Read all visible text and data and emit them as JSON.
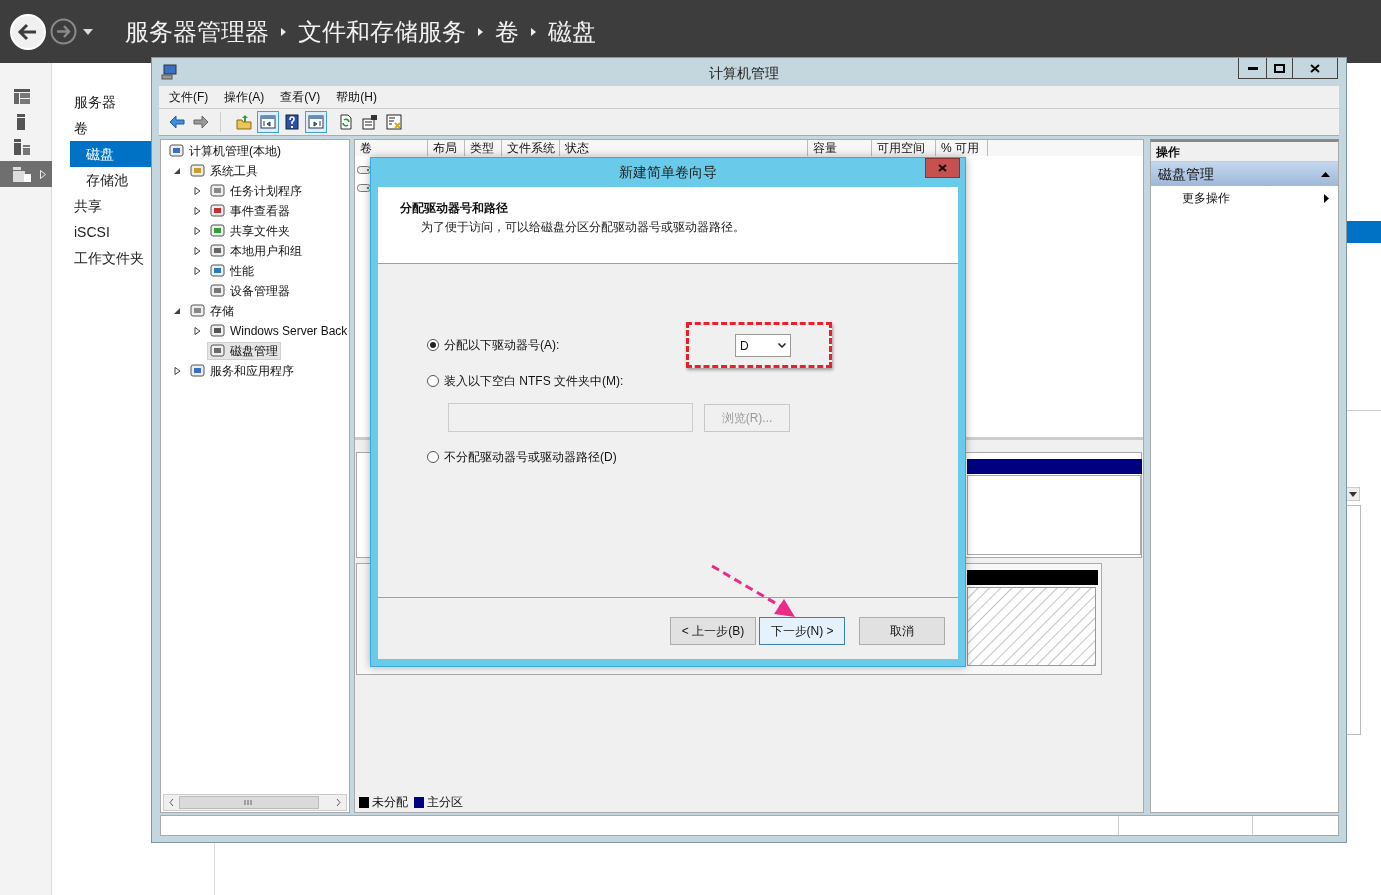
{
  "header": {
    "breadcrumb": [
      "服务器管理器",
      "文件和存储服务",
      "卷",
      "磁盘"
    ]
  },
  "nav": {
    "items": [
      {
        "label": "服务器",
        "selected": false
      },
      {
        "label": "卷",
        "selected": false,
        "children": [
          {
            "label": "磁盘",
            "selected": true
          },
          {
            "label": "存储池",
            "selected": false
          }
        ]
      },
      {
        "label": "共享",
        "selected": false
      },
      {
        "label": "iSCSI",
        "selected": false
      },
      {
        "label": "工作文件夹",
        "selected": false
      }
    ]
  },
  "window": {
    "title": "计算机管理",
    "menu": [
      "文件(F)",
      "操作(A)",
      "查看(V)",
      "帮助(H)"
    ],
    "toolbar": [
      {
        "pressed": false
      },
      {
        "pressed": false
      },
      {
        "pressed": false
      },
      {
        "pressed": true
      },
      {
        "pressed": false
      },
      {
        "pressed": true
      },
      {
        "pressed": false
      },
      {
        "pressed": false
      },
      {
        "pressed": false
      }
    ],
    "tree": [
      {
        "label": "计算机管理(本地)",
        "selected": false,
        "children": [
          {
            "label": "系统工具",
            "expanded": true,
            "selected": false,
            "children": [
              {
                "label": "任务计划程序",
                "expanded": false,
                "selected": false
              },
              {
                "label": "事件查看器",
                "expanded": false,
                "selected": false
              },
              {
                "label": "共享文件夹",
                "expanded": false,
                "selected": false
              },
              {
                "label": "本地用户和组",
                "expanded": false,
                "selected": false
              },
              {
                "label": "性能",
                "expanded": false,
                "selected": false
              },
              {
                "label": "设备管理器",
                "selected": false
              }
            ]
          },
          {
            "label": "存储",
            "expanded": true,
            "selected": false,
            "children": [
              {
                "label": "Windows Server Back",
                "expanded": false,
                "selected": false
              },
              {
                "label": "磁盘管理",
                "selected": true
              }
            ]
          },
          {
            "label": "服务和应用程序",
            "expanded": false,
            "selected": false
          }
        ]
      }
    ],
    "columns": [
      "卷",
      "布局",
      "类型",
      "文件系统",
      "状态",
      "容量",
      "可用空间",
      "% 可用"
    ],
    "legend": [
      {
        "label": "未分配",
        "color": "#000000"
      },
      {
        "label": "主分区",
        "color": "#000080"
      }
    ],
    "actions": {
      "title": "操作",
      "section": "磁盘管理",
      "expanded": true,
      "items": [
        "更多操作"
      ]
    }
  },
  "dialog": {
    "title": "新建简单卷向导",
    "heading": "分配驱动器号和路径",
    "description": "为了便于访问，可以给磁盘分区分配驱动器号或驱动器路径。",
    "options": [
      {
        "kind": "letter",
        "label": "分配以下驱动器号(A):",
        "selected": true,
        "value": "D"
      },
      {
        "kind": "folder",
        "label": "装入以下空白 NTFS 文件夹中(M):",
        "selected": false,
        "browse": "浏览(R)...",
        "disabled": true
      },
      {
        "kind": "plain",
        "label": "不分配驱动器号或驱动器路径(D)",
        "selected": false
      }
    ],
    "buttons": [
      {
        "label": "< 上一步(B)",
        "focused": false
      },
      {
        "label": "下一步(N) >",
        "focused": true
      },
      {
        "label": "取消",
        "focused": false
      }
    ]
  }
}
